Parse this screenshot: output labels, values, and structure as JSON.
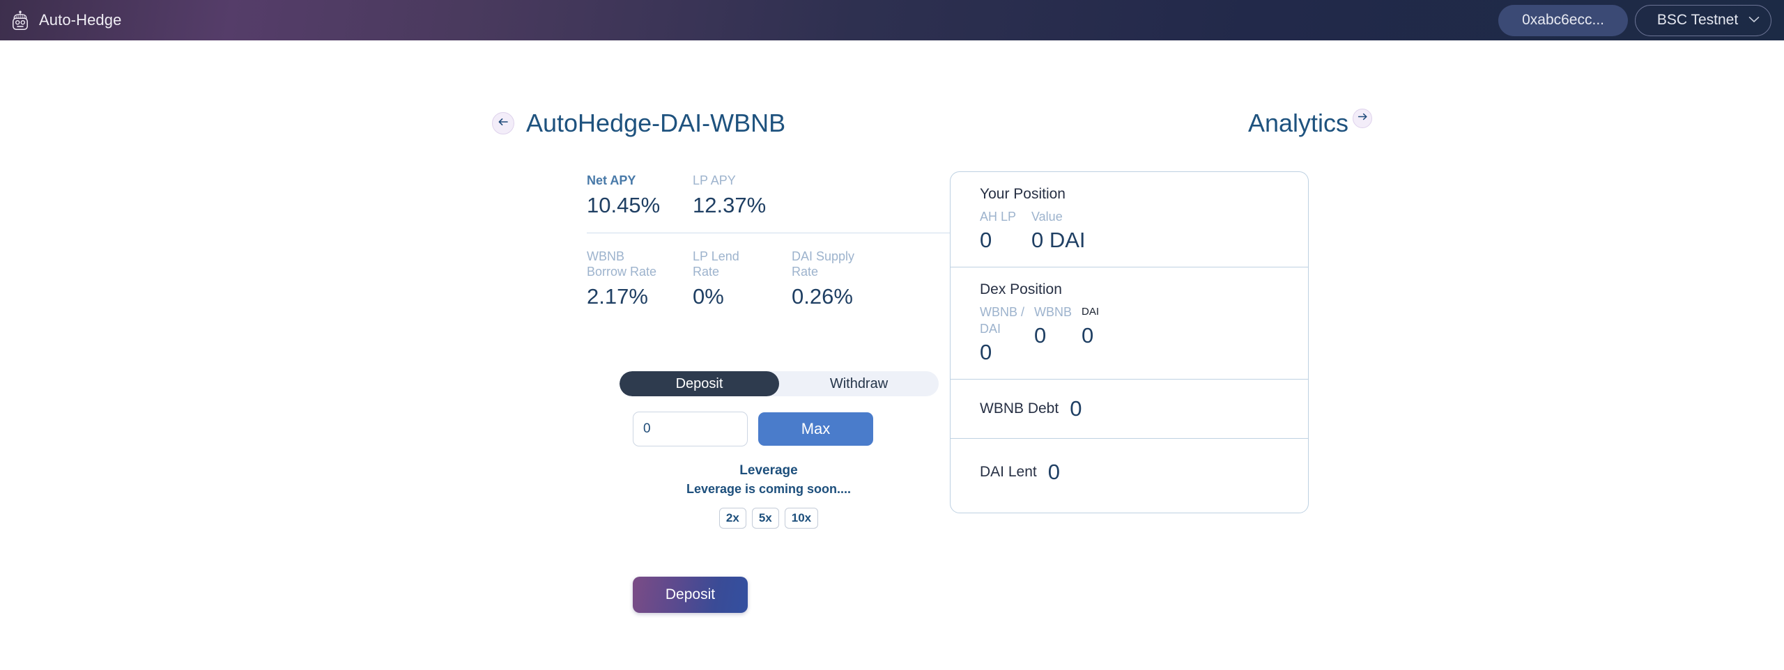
{
  "navbar": {
    "brand_name": "Auto-Hedge",
    "logo_icon": "robot-head-icon",
    "wallet_address": "0xabc6ecc...",
    "network": "BSC Testnet",
    "network_caret_icon": "chevron-down-icon"
  },
  "header": {
    "back_icon": "arrow-left-icon",
    "pool_title": "AutoHedge-DAI-WBNB",
    "analytics_label": "Analytics",
    "analytics_icon": "arrow-right-icon"
  },
  "stats": {
    "row1": [
      {
        "label": "Net APY",
        "value": "10.45%",
        "accent": true
      },
      {
        "label": "LP APY",
        "value": "12.37%",
        "accent": false
      }
    ],
    "row2": [
      {
        "label": "WBNB\nBorrow Rate",
        "value": "2.17%"
      },
      {
        "label": "LP Lend\nRate",
        "value": "0%"
      },
      {
        "label": "DAI Supply\nRate",
        "value": "0.26%"
      }
    ]
  },
  "action_panel": {
    "tabs": [
      {
        "label": "Deposit",
        "active": true
      },
      {
        "label": "Withdraw",
        "active": false
      }
    ],
    "amount_value": "0",
    "amount_placeholder": "0",
    "max_label": "Max",
    "leverage_title": "Leverage",
    "leverage_note": "Leverage is coming soon....",
    "leverage_options": [
      "2x",
      "5x",
      "10x"
    ],
    "submit_label": "Deposit"
  },
  "position_card": {
    "your_position": {
      "heading": "Your Position",
      "columns": [
        {
          "label": "AH LP",
          "value": "0"
        },
        {
          "label": "Value",
          "value": "0 DAI"
        }
      ]
    },
    "dex_position": {
      "heading": "Dex Position",
      "columns": [
        {
          "label": "WBNB / DAI",
          "value": "0"
        },
        {
          "label": "WBNB",
          "value": "0"
        },
        {
          "label": "DAI",
          "value": "0"
        }
      ]
    },
    "wbnb_debt": {
      "label": "WBNB Debt",
      "value": "0"
    },
    "dai_lent": {
      "label": "DAI Lent",
      "value": "0"
    }
  },
  "colors": {
    "header_left": "#553d69",
    "header_right": "#1c2a45",
    "accent_blue": "#4a7ccb",
    "title_blue": "#1e527e",
    "value_blue": "#1f3f63",
    "muted_label": "#9db3cd",
    "tab_active_bg": "#2e3b4e",
    "panel_border": "#bed1e2"
  }
}
